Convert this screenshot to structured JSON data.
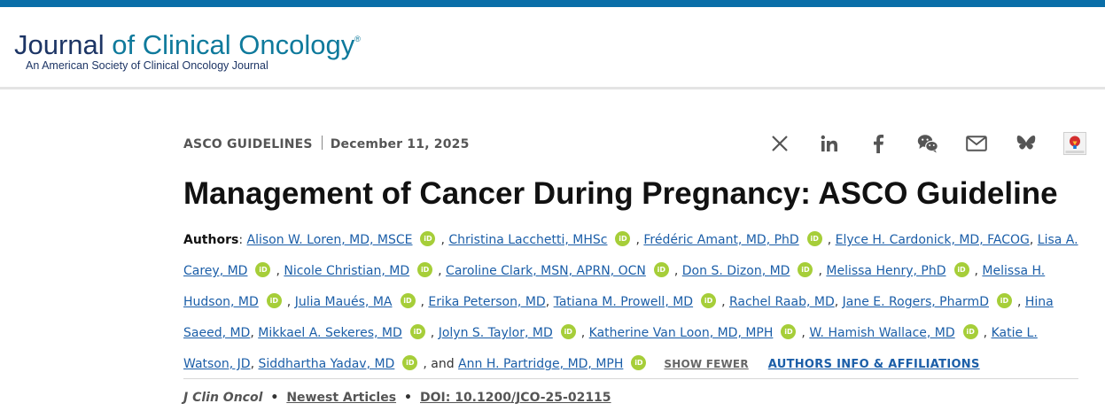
{
  "header": {
    "logo_word1": "Journal",
    "logo_rest": " of Clinical Oncology",
    "logo_reg": "®",
    "logo_subtitle": "An American Society of Clinical Oncology Journal"
  },
  "article": {
    "category": "ASCO GUIDELINES",
    "date": "December 11, 2025",
    "title": "Management of Cancer During Pregnancy: ASCO Guideline",
    "authors_label": "Authors",
    "authors": [
      {
        "name": "Alison W. Loren, MD, MSCE",
        "orcid": true
      },
      {
        "name": "Christina Lacchetti, MHSc",
        "orcid": true
      },
      {
        "name": "Frédéric Amant, MD, PhD",
        "orcid": true
      },
      {
        "name": "Elyce H. Cardonick, MD, FACOG",
        "orcid": false
      },
      {
        "name": "Lisa A. Carey, MD",
        "orcid": true
      },
      {
        "name": "Nicole Christian, MD",
        "orcid": true
      },
      {
        "name": "Caroline Clark, MSN, APRN, OCN",
        "orcid": true
      },
      {
        "name": "Don S. Dizon, MD",
        "orcid": true
      },
      {
        "name": "Melissa Henry, PhD",
        "orcid": true
      },
      {
        "name": "Melissa H. Hudson, MD",
        "orcid": true
      },
      {
        "name": "Julia Maués, MA",
        "orcid": true
      },
      {
        "name": "Erika Peterson, MD",
        "orcid": false
      },
      {
        "name": "Tatiana M. Prowell, MD",
        "orcid": true
      },
      {
        "name": "Rachel Raab, MD",
        "orcid": false
      },
      {
        "name": "Jane E. Rogers, PharmD",
        "orcid": true
      },
      {
        "name": "Hina Saeed, MD",
        "orcid": false
      },
      {
        "name": "Mikkael A. Sekeres, MD",
        "orcid": true
      },
      {
        "name": "Jolyn S. Taylor, MD",
        "orcid": true
      },
      {
        "name": "Katherine Van Loon, MD, MPH",
        "orcid": true
      },
      {
        "name": "W. Hamish Wallace, MD",
        "orcid": true
      },
      {
        "name": "Katie L. Watson, JD",
        "orcid": false
      },
      {
        "name": "Siddhartha Yadav, MD",
        "orcid": true
      },
      {
        "name": "Ann H. Partridge, MD, MPH",
        "orcid": true
      }
    ],
    "and_text": "and",
    "orcid_label": "iD",
    "show_fewer": "SHOW FEWER",
    "authors_info": "AUTHORS INFO & AFFILIATIONS",
    "citation": {
      "journal": "J Clin Oncol",
      "section": "Newest Articles",
      "doi": "DOI: 10.1200/JCO-25-02115"
    }
  },
  "share_icons": [
    "x-icon",
    "linkedin-icon",
    "facebook-icon",
    "wechat-icon",
    "email-icon",
    "bluesky-icon",
    "mendeley-icon"
  ],
  "colors": {
    "top_bar": "#0a6ea8",
    "link": "#1b5ea8",
    "orcid": "#a6ce39",
    "logo_dark": "#1d3565",
    "logo_teal": "#0f7a9c"
  }
}
